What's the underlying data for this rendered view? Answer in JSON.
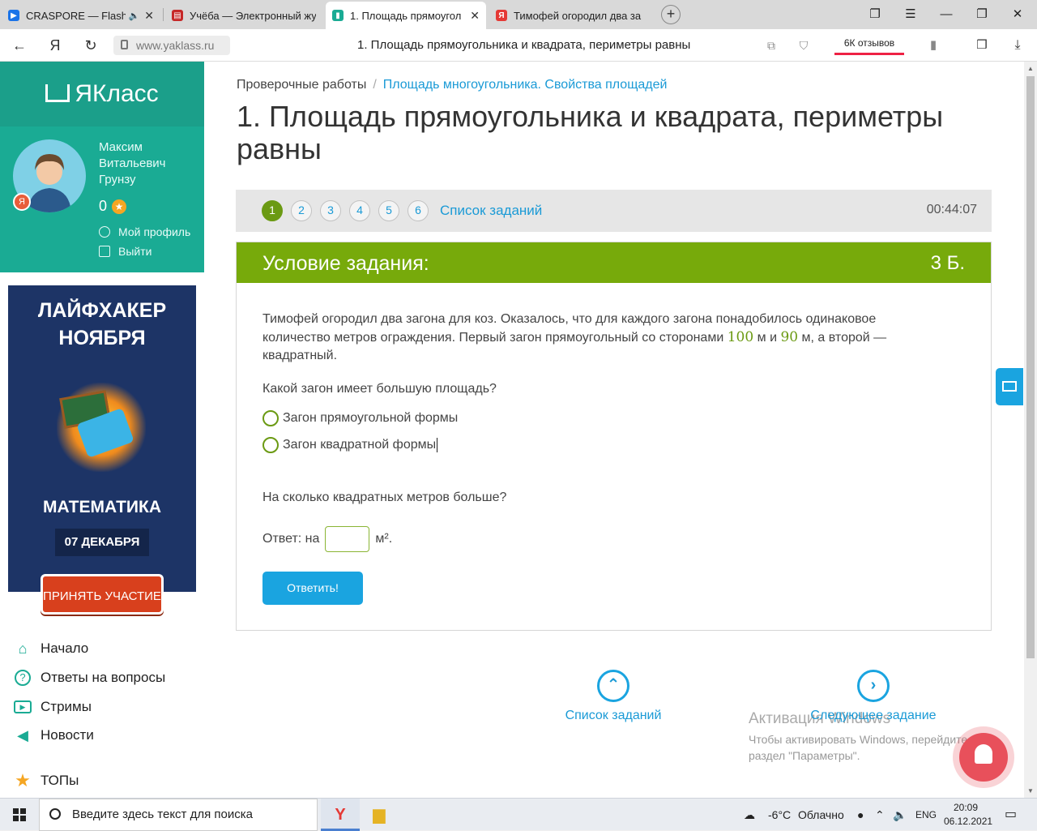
{
  "browser": {
    "tabs": [
      {
        "title": "CRASPORE — Flashb",
        "favicon_color": "#1a73e8"
      },
      {
        "title": "Учёба — Электронный жу",
        "favicon_color": "#c62828"
      },
      {
        "title": "1. Площадь прямоугол",
        "favicon_color": "#1aab94"
      },
      {
        "title": "Тимофей огородил два за",
        "favicon_color": "#e53935"
      }
    ],
    "url": "www.yaklass.ru",
    "page_title": "1. Площадь прямоугольника и квадрата, периметры равны",
    "reviews": "6К отзывов"
  },
  "sidebar": {
    "logo": "ЯКласс",
    "user_name": "Максим Витальевич Грунзу",
    "points": "0",
    "profile_link": "Мой профиль",
    "logout_link": "Выйти",
    "ad": {
      "headline": "ЛАЙФХАКЕР НОЯБРЯ",
      "subject": "МАТЕМАТИКА",
      "date": "07 ДЕКАБРЯ",
      "button": "ПРИНЯТЬ УЧАСТИЕ"
    },
    "nav": [
      {
        "label": "Начало",
        "icon": "home-icon"
      },
      {
        "label": "Ответы на вопросы",
        "icon": "question-icon"
      },
      {
        "label": "Стримы",
        "icon": "play-icon"
      },
      {
        "label": "Новости",
        "icon": "megaphone-icon"
      },
      {
        "label": "ТОПы",
        "icon": "star-icon"
      }
    ]
  },
  "main": {
    "breadcrumb": {
      "root": "Проверочные работы",
      "current": "Площадь многоугольника. Свойства площадей"
    },
    "title": "1. Площадь прямоугольника и квадрата, периметры равны",
    "steps": [
      "1",
      "2",
      "3",
      "4",
      "5",
      "6"
    ],
    "active_step": "1",
    "task_list": "Список заданий",
    "timer": "00:44:07",
    "card_title": "Условие задания:",
    "card_points": "3 Б.",
    "task_text_1": "Тимофей огородил два загона для коз. Оказалось, что для каждого загона понадобилось одинаковое количество метров ограждения. Первый загон прямоугольный со сторонами ",
    "side_a": "100",
    "task_text_2": " м и ",
    "side_b": "90",
    "task_text_3": " м, а второй — квадратный.",
    "question_1": "Какой загон имеет большую площадь?",
    "option_1": "Загон прямоугольной формы",
    "option_2": "Загон квадратной формы",
    "question_2": "На сколько квадратных метров больше?",
    "answer_prefix": "Ответ: на",
    "answer_value": "",
    "answer_unit": "м².",
    "submit": "Ответить!",
    "bottom_list": "Список заданий",
    "bottom_next": "Следующее задание",
    "watermark_title": "Активация Windows",
    "watermark_text": "Чтобы активировать Windows, перейдите в раздел \"Параметры\"."
  },
  "taskbar": {
    "search_placeholder": "Введите здесь текст для поиска",
    "temp": "-6°C",
    "weather": "Облачно",
    "lang": "ENG",
    "time": "20:09",
    "date": "06.12.2021"
  },
  "colors": {
    "accent_teal": "#1aab94",
    "accent_green": "#77aa0b",
    "link_blue": "#1a9ad6"
  }
}
